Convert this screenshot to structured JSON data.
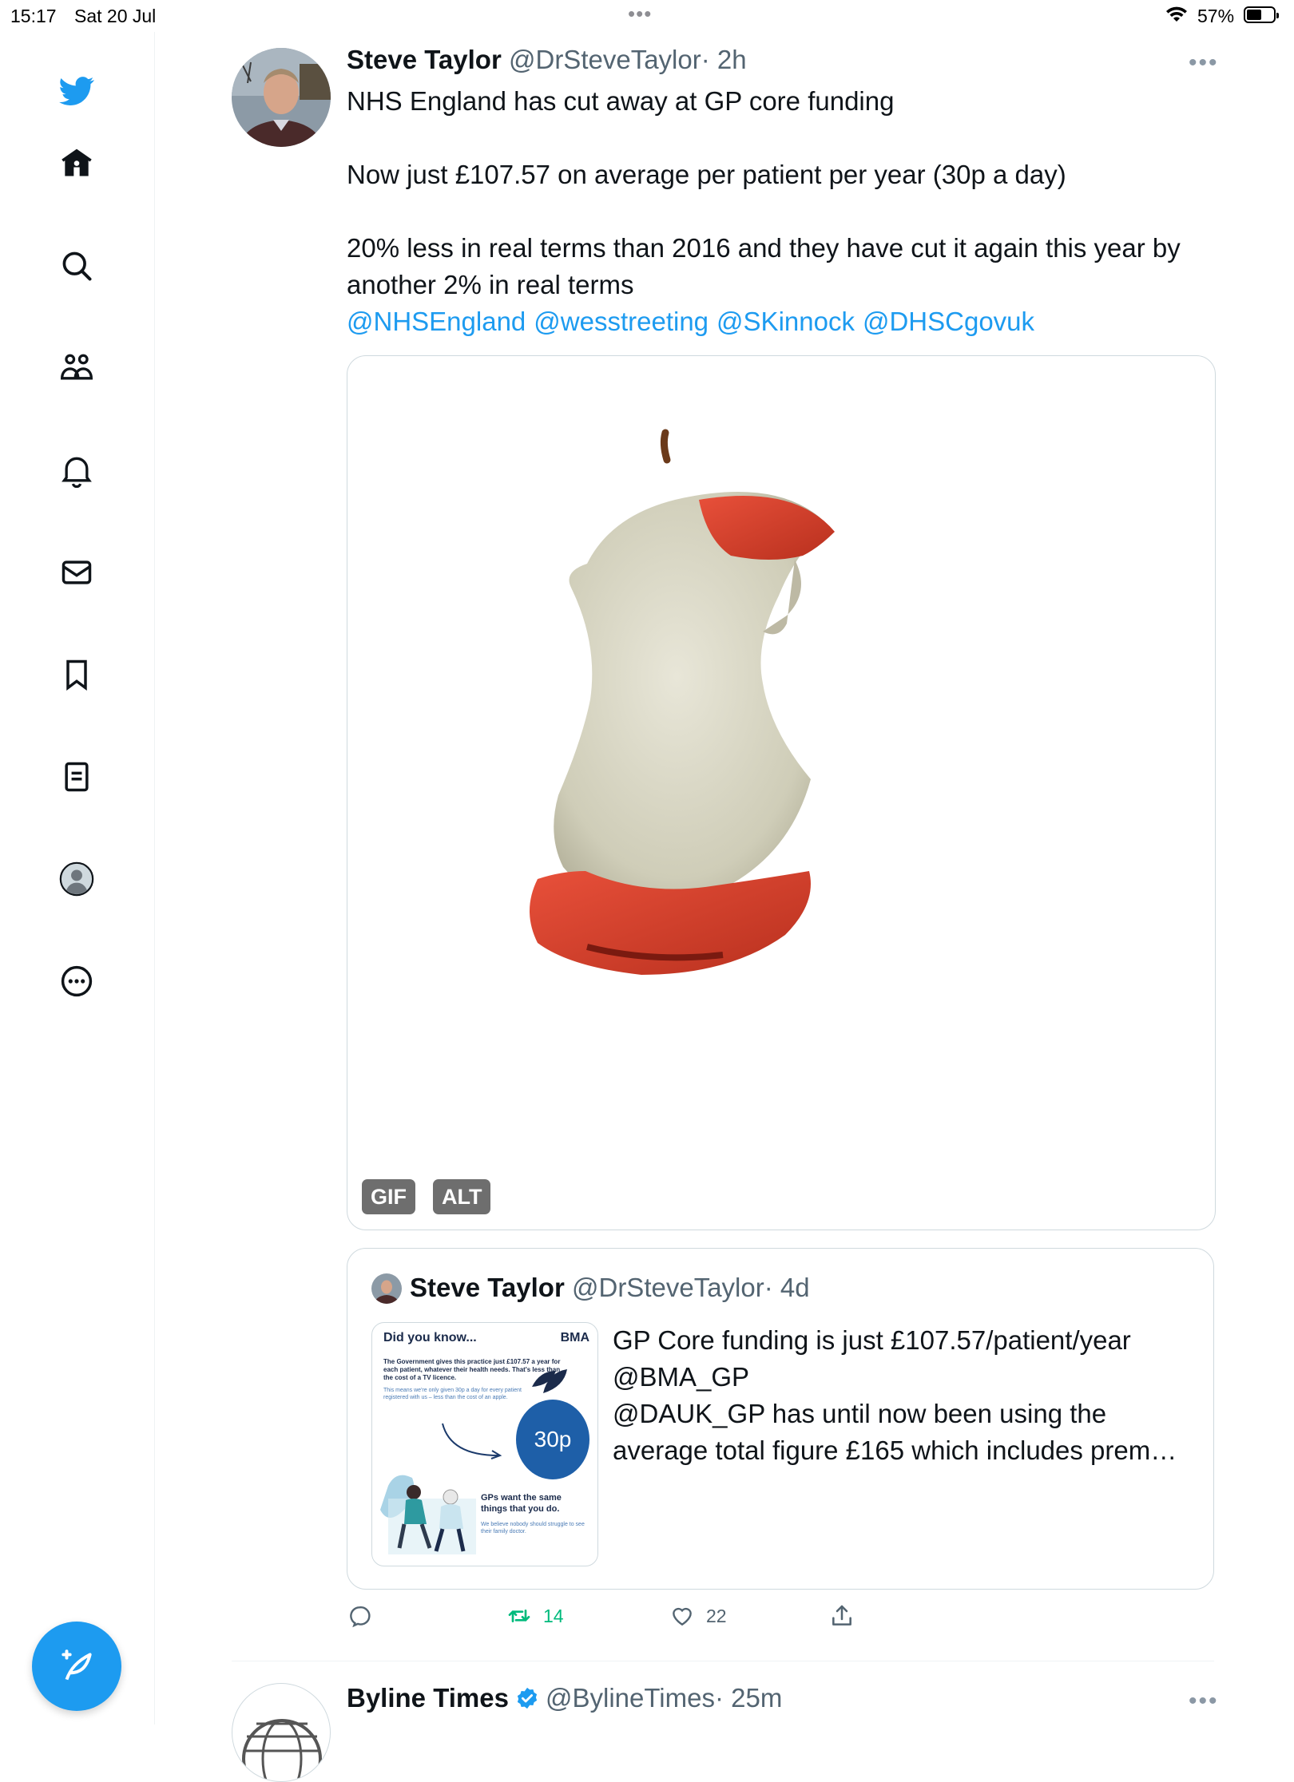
{
  "status_bar": {
    "time": "15:17",
    "date": "Sat 20 Jul",
    "multitask_dots": "•••",
    "battery_percent": "57%",
    "battery_level": 0.57
  },
  "sidebar": {
    "items": [
      {
        "name": "twitter-logo-icon"
      },
      {
        "name": "home-icon"
      },
      {
        "name": "search-icon"
      },
      {
        "name": "communities-icon"
      },
      {
        "name": "notifications-icon"
      },
      {
        "name": "messages-icon"
      },
      {
        "name": "bookmarks-icon"
      },
      {
        "name": "lists-icon"
      },
      {
        "name": "profile-icon"
      },
      {
        "name": "more-icon"
      }
    ],
    "compose": {
      "icon": "compose-tweet-icon",
      "color": "#1d9bf0"
    }
  },
  "tweet": {
    "author_name": "Steve Taylor",
    "author_handle": "@DrSteveTaylor",
    "time": "· 2h",
    "more": "•••",
    "line1": "NHS England has cut away at GP core funding",
    "line2": "Now just £107.57 on average per patient per year (30p a day)",
    "line3": "20% less in real terms than 2016 and they have cut it again this year by another 2% in real terms",
    "mentions": [
      "@NHSEngland",
      "@wesstreeting",
      "@SKinnock",
      "@DHSCgovuk"
    ],
    "media": {
      "description_icon": "eaten-apple-core-gif",
      "gif_badge": "GIF",
      "alt_badge": "ALT"
    },
    "quote": {
      "author_name": "Steve Taylor",
      "author_handle": "@DrSteveTaylor",
      "time": "· 4d",
      "text_lines": [
        "GP Core funding is just £107.57/patient/year",
        "@BMA_GP",
        "@DAUK_GP has until now been using the",
        "average total figure £165 which includes prem…"
      ],
      "thumb": {
        "title": "Did you know...",
        "logo": "BMA",
        "body": "The Government gives this practice just £107.57 a year for each patient, whatever their health needs. That's less than the cost of a TV licence.",
        "sub": "This means we're only given 30p a day for every patient registered with us – less than the cost of an apple.",
        "apple_label": "30p",
        "cta": "GPs want the same things that you do.",
        "foot": "We believe nobody should struggle to see their family doctor."
      }
    },
    "actions": {
      "reply_count": "",
      "retweet_count": "14",
      "like_count": "22",
      "retweet_color": "#00ba7c"
    }
  },
  "next_tweet": {
    "author_name": "Byline Times",
    "author_handle": "@BylineTimes",
    "time": "· 25m",
    "more": "•••",
    "verified_color": "#1d9bf0"
  }
}
